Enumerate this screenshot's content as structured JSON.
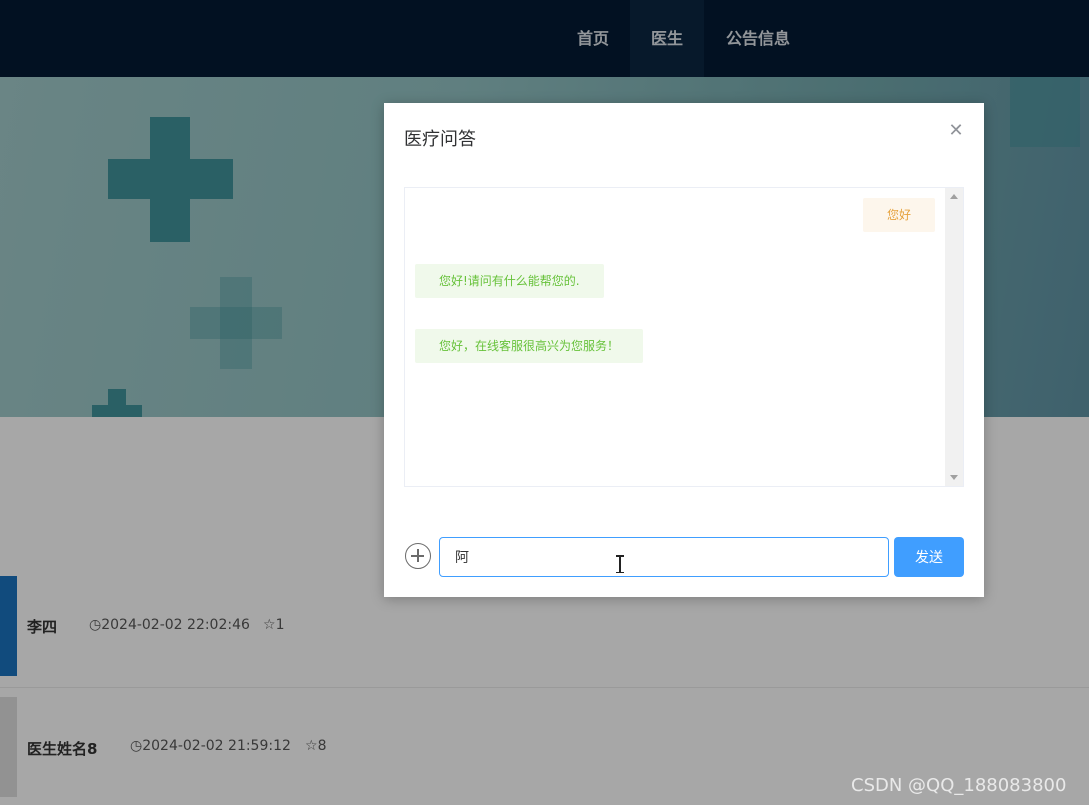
{
  "nav": {
    "items": [
      {
        "label": "首页",
        "active": false
      },
      {
        "label": "医生",
        "active": true
      },
      {
        "label": "公告信息",
        "active": false
      }
    ]
  },
  "doctors": [
    {
      "name": "李四",
      "time": "2024-02-02 22:02:46",
      "stars": "1"
    },
    {
      "name": "医生姓名8",
      "time": "2024-02-02 21:59:12",
      "stars": "8"
    }
  ],
  "dialog": {
    "title": "医疗问答",
    "messages": [
      {
        "text": "您好",
        "side": "right"
      },
      {
        "text": "您好!请问有什么能帮您的.",
        "side": "left"
      },
      {
        "text": "您好，在线客服很高兴为您服务！",
        "side": "left"
      }
    ],
    "input_value": "阿",
    "send_label": "发送"
  },
  "watermark": "CSDN @QQ_188083800",
  "colors": {
    "primary": "#409eff",
    "nav_bg": "#041a33",
    "reply_text": "#67c23a",
    "me_text": "#e6a23c"
  }
}
